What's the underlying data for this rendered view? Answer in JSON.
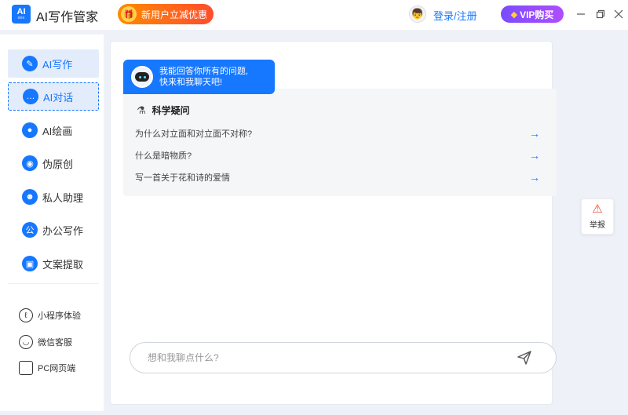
{
  "titlebar": {
    "logo_text": "AI",
    "logo_sub": "写作管家",
    "app_title": "AI写作管家",
    "promo_label": "新用户立减优惠",
    "login_label": "登录/注册",
    "vip_label": "VIP购买"
  },
  "sidebar": {
    "items": [
      {
        "label": "AI写作",
        "icon": "pencil-icon"
      },
      {
        "label": "AI对话",
        "icon": "chat-icon"
      },
      {
        "label": "AI绘画",
        "icon": "palette-icon"
      },
      {
        "label": "伪原创",
        "icon": "lightbulb-icon"
      },
      {
        "label": "私人助理",
        "icon": "assistant-icon"
      },
      {
        "label": "办公写作",
        "icon": "office-icon"
      },
      {
        "label": "文案提取",
        "icon": "extract-icon"
      }
    ],
    "links": [
      {
        "label": "小程序体验",
        "icon": "mini-program-icon"
      },
      {
        "label": "微信客服",
        "icon": "wechat-service-icon"
      },
      {
        "label": "PC网页端",
        "icon": "pc-web-icon"
      }
    ]
  },
  "chat": {
    "bot_greeting_line1": "我能回答你所有的问题,",
    "bot_greeting_line2": "快来和我聊天吧!",
    "suggestion_title": "科学疑问",
    "suggestions": [
      "为什么对立面和对立面不对称?",
      "什么是暗物质?",
      "写一首关于花和诗的爱情"
    ],
    "input_placeholder": "想和我聊点什么?"
  },
  "report": {
    "label": "举报"
  },
  "colors": {
    "accent": "#1677ff",
    "promo": "#ff6a1a",
    "vip": "#8a4bff"
  }
}
